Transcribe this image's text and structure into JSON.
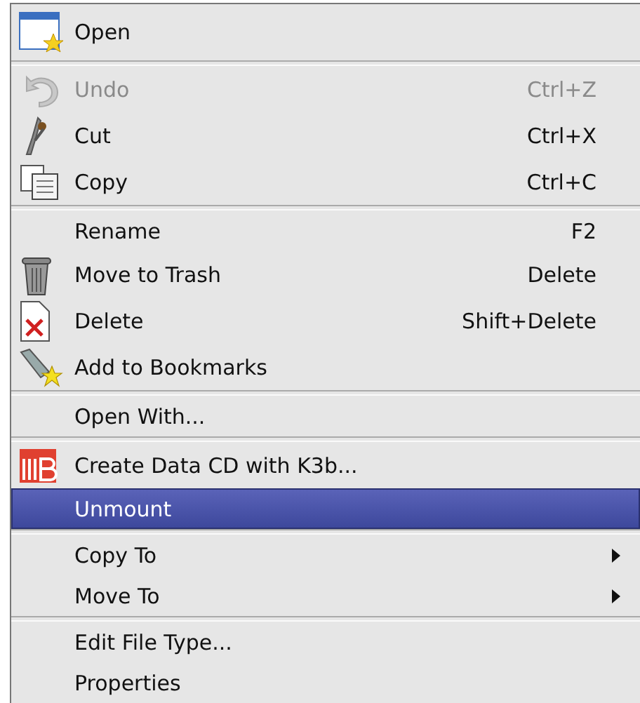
{
  "menu": {
    "items": [
      {
        "kind": "item",
        "label": "Open",
        "disabled": false,
        "selected": false
      },
      {
        "kind": "separator"
      },
      {
        "kind": "item",
        "label": "Undo",
        "shortcut": "Ctrl+Z",
        "disabled": true,
        "selected": false
      },
      {
        "kind": "item",
        "label": "Cut",
        "shortcut": "Ctrl+X",
        "disabled": false,
        "selected": false
      },
      {
        "kind": "item",
        "label": "Copy",
        "shortcut": "Ctrl+C",
        "disabled": false,
        "selected": false
      },
      {
        "kind": "separator"
      },
      {
        "kind": "item",
        "label": "Rename",
        "shortcut": "F2",
        "disabled": false,
        "selected": false
      },
      {
        "kind": "item",
        "label": "Move to Trash",
        "shortcut": "Delete",
        "disabled": false,
        "selected": false
      },
      {
        "kind": "item",
        "label": "Delete",
        "shortcut": "Shift+Delete",
        "disabled": false,
        "selected": false
      },
      {
        "kind": "item",
        "label": "Add to Bookmarks",
        "disabled": false,
        "selected": false
      },
      {
        "kind": "separator"
      },
      {
        "kind": "item",
        "label": "Open With...",
        "disabled": false,
        "selected": false
      },
      {
        "kind": "separator"
      },
      {
        "kind": "item",
        "label": "Create Data CD with K3b...",
        "disabled": false,
        "selected": false
      },
      {
        "kind": "item",
        "label": "Unmount",
        "disabled": false,
        "selected": true
      },
      {
        "kind": "separator"
      },
      {
        "kind": "item",
        "label": "Copy To",
        "submenu": true,
        "disabled": false,
        "selected": false
      },
      {
        "kind": "item",
        "label": "Move To",
        "submenu": true,
        "disabled": false,
        "selected": false
      },
      {
        "kind": "separator"
      },
      {
        "kind": "item",
        "label": "Edit File Type...",
        "disabled": false,
        "selected": false
      },
      {
        "kind": "item",
        "label": "Properties",
        "disabled": false,
        "selected": false
      }
    ]
  }
}
